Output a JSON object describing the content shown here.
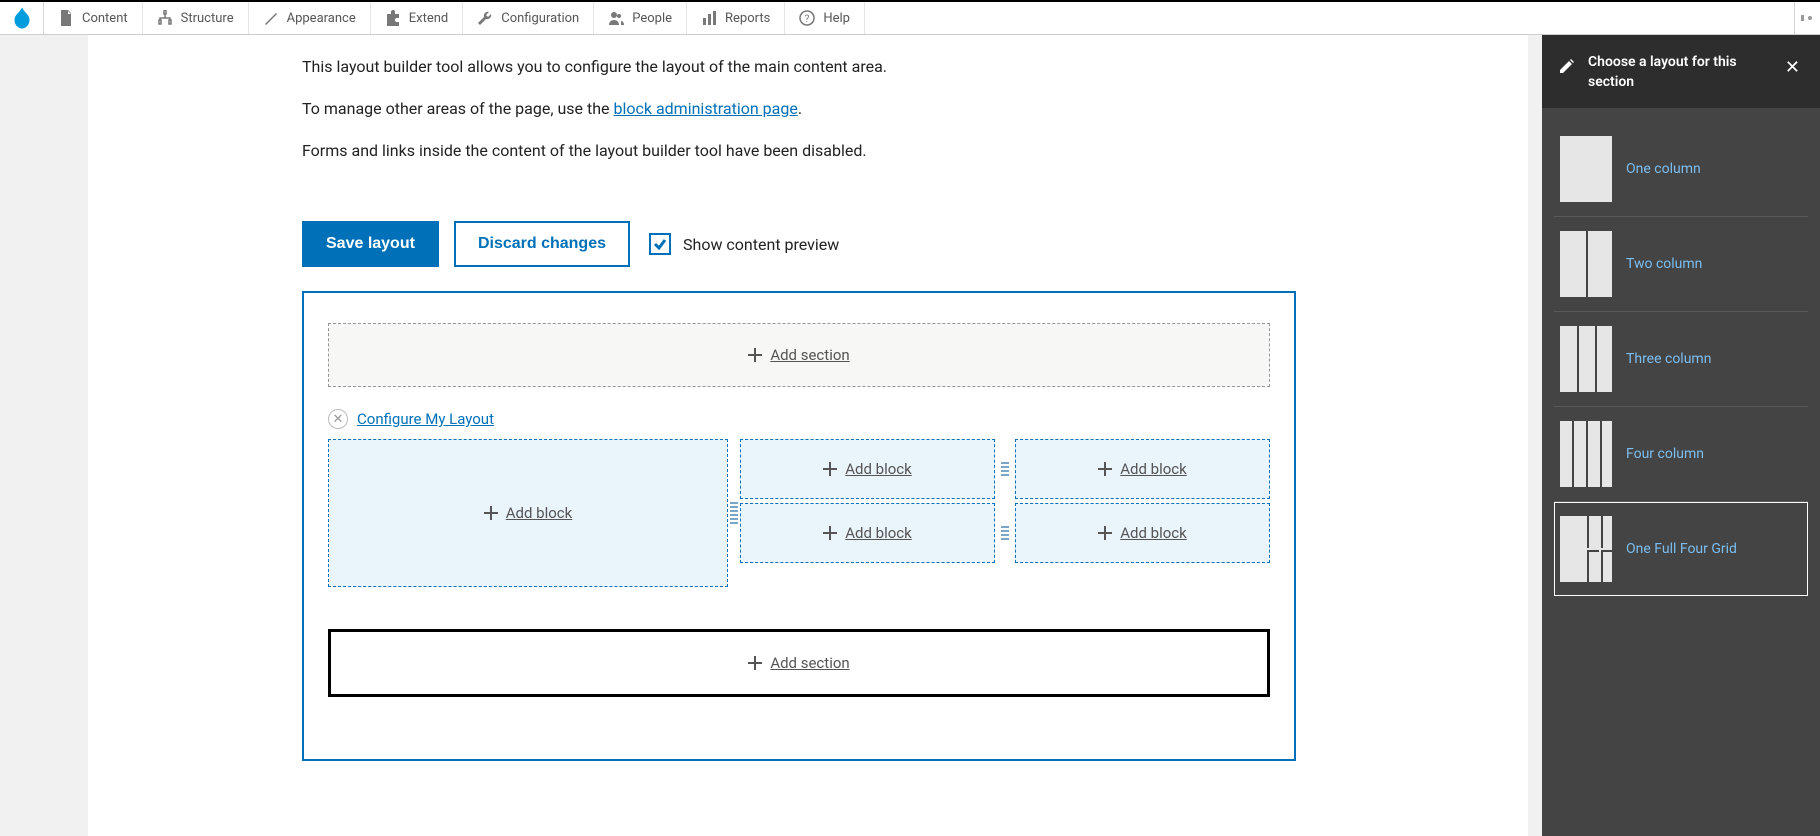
{
  "toolbar": {
    "items": [
      "Content",
      "Structure",
      "Appearance",
      "Extend",
      "Configuration",
      "People",
      "Reports",
      "Help"
    ]
  },
  "intro": {
    "line1": "This layout builder tool allows you to configure the layout of the main content area.",
    "line2_prefix": "To manage other areas of the page, use the ",
    "line2_link": "block administration page",
    "line2_suffix": ".",
    "line3": "Forms and links inside the content of the layout builder tool have been disabled."
  },
  "actions": {
    "save": "Save layout",
    "discard": "Discard changes",
    "preview_label": "Show content preview",
    "preview_checked": true
  },
  "builder": {
    "add_section": "Add section",
    "configure_link": "Configure My Layout",
    "add_block": "Add block"
  },
  "offcanvas": {
    "title": "Choose a layout for this section",
    "options": [
      {
        "label": "One column"
      },
      {
        "label": "Two column"
      },
      {
        "label": "Three column"
      },
      {
        "label": "Four column"
      },
      {
        "label": "One Full Four Grid"
      }
    ],
    "selected_index": 4
  }
}
